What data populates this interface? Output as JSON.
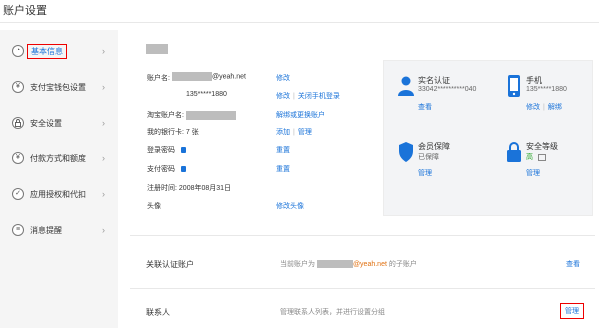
{
  "page": {
    "title": "账户设置"
  },
  "sidebar": {
    "items": [
      {
        "label": "基本信息",
        "icon": "person-icon",
        "glyph": "◔",
        "arrow": "›"
      },
      {
        "label": "支付宝钱包设置",
        "icon": "wallet-icon",
        "glyph": "¥",
        "arrow": "›"
      },
      {
        "label": "安全设置",
        "icon": "lock-icon",
        "glyph": "🔒",
        "arrow": "›"
      },
      {
        "label": "付款方式和额度",
        "icon": "yuan-icon",
        "glyph": "¥",
        "arrow": "›"
      },
      {
        "label": "应用授权和代扣",
        "icon": "check-icon",
        "glyph": "✓",
        "arrow": "›"
      },
      {
        "label": "消息提醒",
        "icon": "message-icon",
        "glyph": "≡",
        "arrow": "›"
      }
    ]
  },
  "account": {
    "account_name_label": "账户名:",
    "account_email_suffix": "@yeah.net",
    "account_modify": "修改",
    "phone": "135*****1880",
    "phone_modify": "修改",
    "phone_close": "关闭手机登录",
    "taobao_label": "淘宝账户名:",
    "taobao_action": "解绑或更换账户",
    "cards_label": "我的银行卡:",
    "cards_count": "7 张",
    "cards_add": "添加",
    "cards_manage": "管理",
    "login_pwd_label": "登录密码",
    "login_pwd_action": "重置",
    "pay_pwd_label": "支付密码",
    "pay_pwd_action": "重置",
    "reg_label": "注册时间:",
    "reg_date": "2008年08月31日",
    "avatar_label": "头像",
    "avatar_action": "修改头像"
  },
  "status_panel": {
    "realname": {
      "title": "实名认证",
      "id": "33042**********040",
      "link": "查看"
    },
    "mobile": {
      "title": "手机",
      "number": "135*****1880",
      "modify": "修改",
      "unbind": "解绑"
    },
    "protection": {
      "title": "会员保障",
      "status": "已保障",
      "link": "管理"
    },
    "security": {
      "title": "安全等级",
      "level": "高",
      "link": "管理"
    }
  },
  "linked": {
    "title": "关联认证账户",
    "desc_prefix": "当前账户为",
    "desc_email": "@yeah.net",
    "desc_suffix": " 的子账户",
    "link": "查看"
  },
  "contacts": {
    "title": "联系人",
    "desc": "管理联系人列表，并进行设置分组",
    "link": "管理"
  },
  "colors": {
    "accent": "#1a73d9",
    "highlight_border": "#e00000",
    "level_high": "#2aa52a"
  }
}
